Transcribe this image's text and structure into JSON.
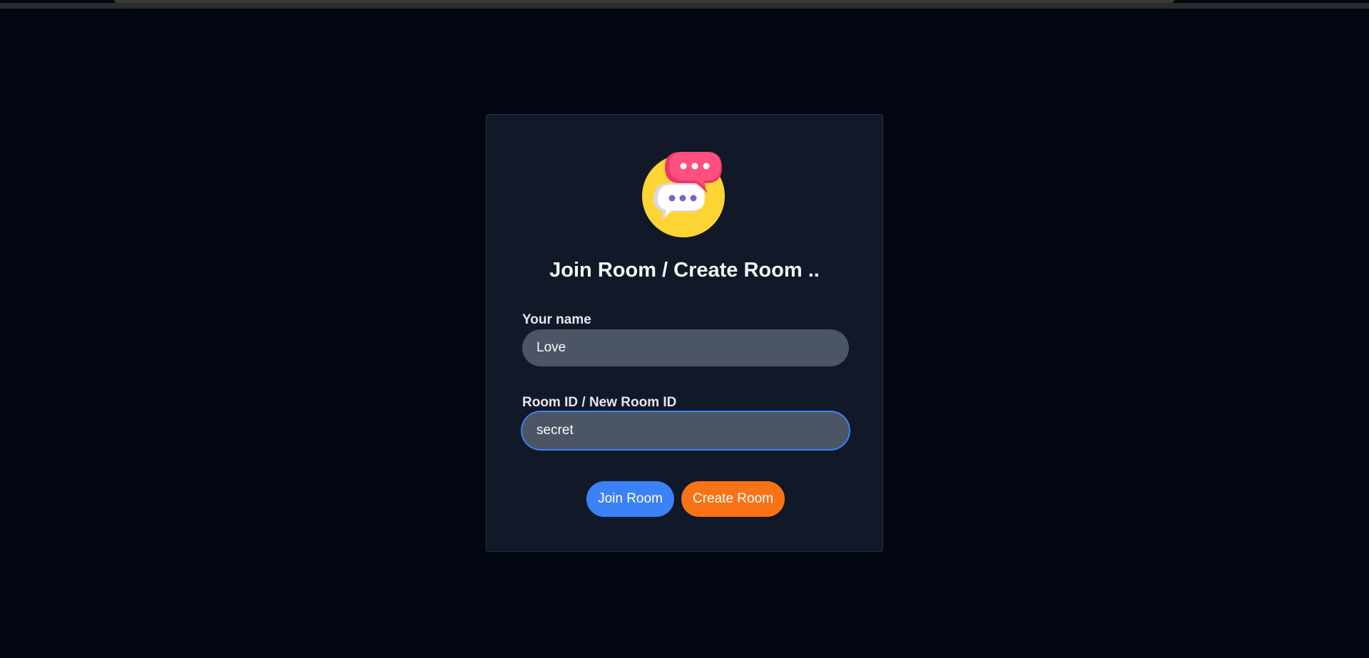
{
  "app": {
    "title": "Join Room / Create Room .."
  },
  "form": {
    "name_label": "Your name",
    "name_value": "Love",
    "room_label": "Room ID / New Room ID",
    "room_value": "secret"
  },
  "actions": {
    "join_label": "Join Room",
    "create_label": "Create Room"
  },
  "icons": {
    "logo": "chat-bubbles-icon"
  },
  "colors": {
    "background": "#010611",
    "card": "#111827",
    "input": "#4b5563",
    "focus_ring": "#3b82f6",
    "join_button": "#3b82f6",
    "create_button": "#f97316",
    "logo_circle": "#fcd535",
    "logo_pink_bubble": "#ff4f7e",
    "logo_white_bubble": "#ffffff",
    "logo_dots": "#7b61c9"
  }
}
